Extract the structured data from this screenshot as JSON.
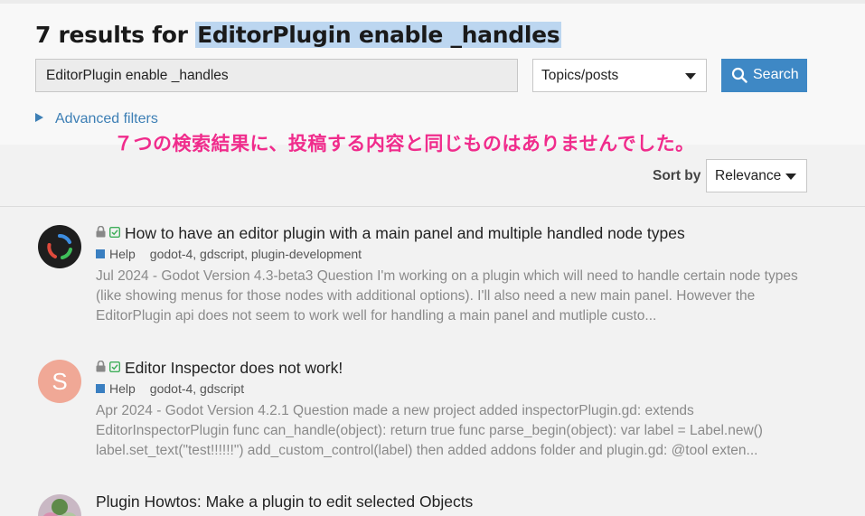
{
  "header": {
    "results_prefix": "7 results for",
    "query": "EditorPlugin enable _handles"
  },
  "search": {
    "input_value": "EditorPlugin enable _handles",
    "type_select": "Topics/posts",
    "button_label": "Search"
  },
  "advanced_filters_label": "Advanced filters",
  "overlay_text": "７つの検索結果に、投稿する内容と同じものはありませんでした。",
  "sort": {
    "label": "Sort by",
    "value": "Relevance"
  },
  "results": [
    {
      "title": "How to have an editor plugin with a main panel and multiple handled node types",
      "category": "Help",
      "tags": "godot-4, gdscript, plugin-development",
      "date": "Jul 2024",
      "separator": " - ",
      "blurb": "Godot Version 4.3-beta3 Question I'm working on a plugin which will need to handle certain node types (like showing menus for those nodes with additional options). I'll also need a new main panel. However the EditorPlugin api does not seem to work well for handling a main panel and mutliple custo..."
    },
    {
      "avatar_letter": "S",
      "title": "Editor Inspector does not work!",
      "category": "Help",
      "tags": "godot-4, gdscript",
      "date": "Apr 2024",
      "separator": " - ",
      "blurb": "Godot Version 4.2.1 Question made a new project added inspectorPlugin.gd: extends EditorInspectorPlugin func can_handle(object): return true func parse_begin(object): var label = Label.new() label.set_text(\"test!!!!!!\") add_custom_control(label) then added addons folder and plugin.gd: @tool exten..."
    },
    {
      "title": "Plugin Howtos: Make a plugin to edit selected Objects"
    }
  ],
  "colors": {
    "accent": "#3e88c5",
    "overlay": "#f02c8c",
    "avatar_s": "#f0a896"
  }
}
